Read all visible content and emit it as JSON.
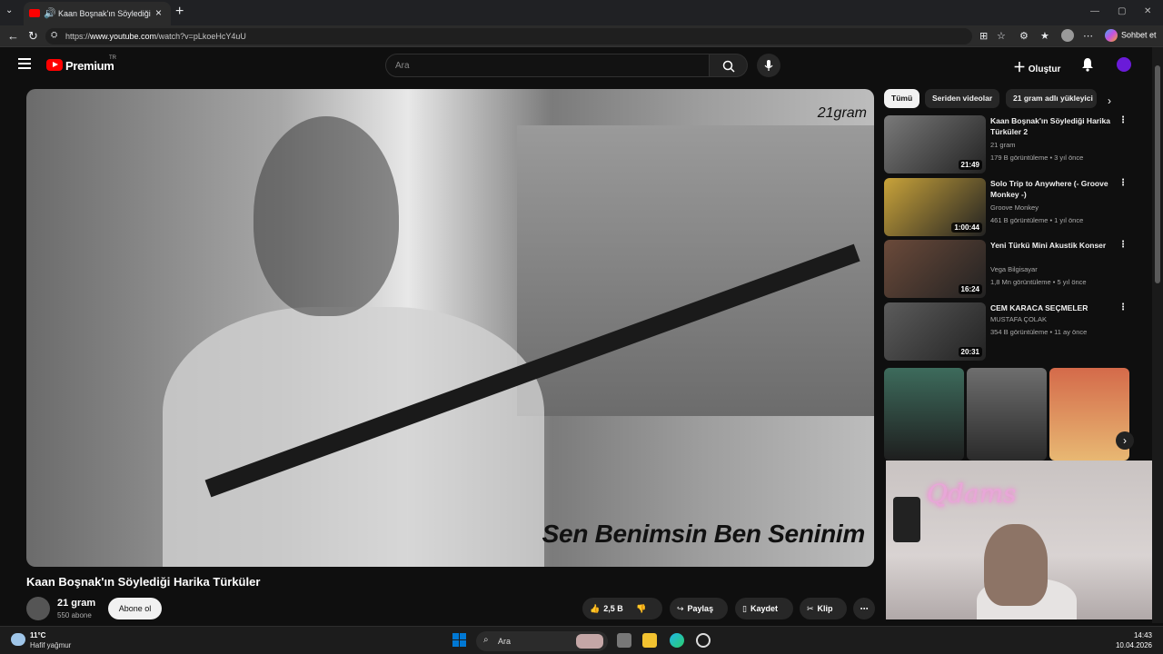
{
  "browser": {
    "tab_title": "Kaan Boşnak'ın Söylediği Harika Türküler",
    "url_prefix": "https://",
    "url_host": "www.youtube.com",
    "url_path": "/watch?v=pLkoeHcY4uU",
    "copilot_label": "Sohbet et"
  },
  "header": {
    "brand": "Premium",
    "country": "TR",
    "search_placeholder": "Ara",
    "create_label": "Oluştur"
  },
  "video": {
    "watermark": "21gram",
    "caption": "Sen Benimsin Ben Seninim",
    "title": "Kaan Boşnak'ın Söylediği Harika Türküler",
    "channel": "21 gram",
    "subscribers": "550 abone",
    "subscribe_label": "Abone ol",
    "likes": "2,5 B",
    "share_label": "Paylaş",
    "save_label": "Kaydet",
    "clip_label": "Klip"
  },
  "sidebar": {
    "chips": [
      "Tümü",
      "Seriden videolar",
      "21 gram adlı yükleyici"
    ],
    "recommendations": [
      {
        "title": "Kaan Boşnak'ın Söylediği Harika Türküler 2",
        "channel": "21 gram",
        "meta": "179 B görüntüleme • 3 yıl önce",
        "duration": "21:49",
        "thumb_color": "#7a7a7a"
      },
      {
        "title": "Solo Trip to Anywhere (- Groove Monkey -)",
        "channel": "Groove Monkey",
        "meta": "461 B görüntüleme • 1 yıl önce",
        "duration": "1:00:44",
        "thumb_color": "#c9a33a"
      },
      {
        "title": "Yeni Türkü Mini Akustik Konser",
        "channel": "Vega Bilgisayar",
        "meta": "1,8 Mn görüntüleme • 5 yıl önce",
        "duration": "16:24",
        "thumb_color": "#6b4a3a"
      },
      {
        "title": "CEM KARACA SEÇMELER",
        "channel": "MUSTAFA ÇOLAK",
        "meta": "354 B görüntüleme • 11 ay önce",
        "duration": "20:31",
        "thumb_color": "#5c5c5c"
      }
    ]
  },
  "overlay": {
    "neon_text": "Qdams"
  },
  "taskbar": {
    "temperature": "11°C",
    "weather": "Hafif yağmur",
    "search_placeholder": "Ara",
    "time": "14:43",
    "date": "10.04.2026"
  }
}
